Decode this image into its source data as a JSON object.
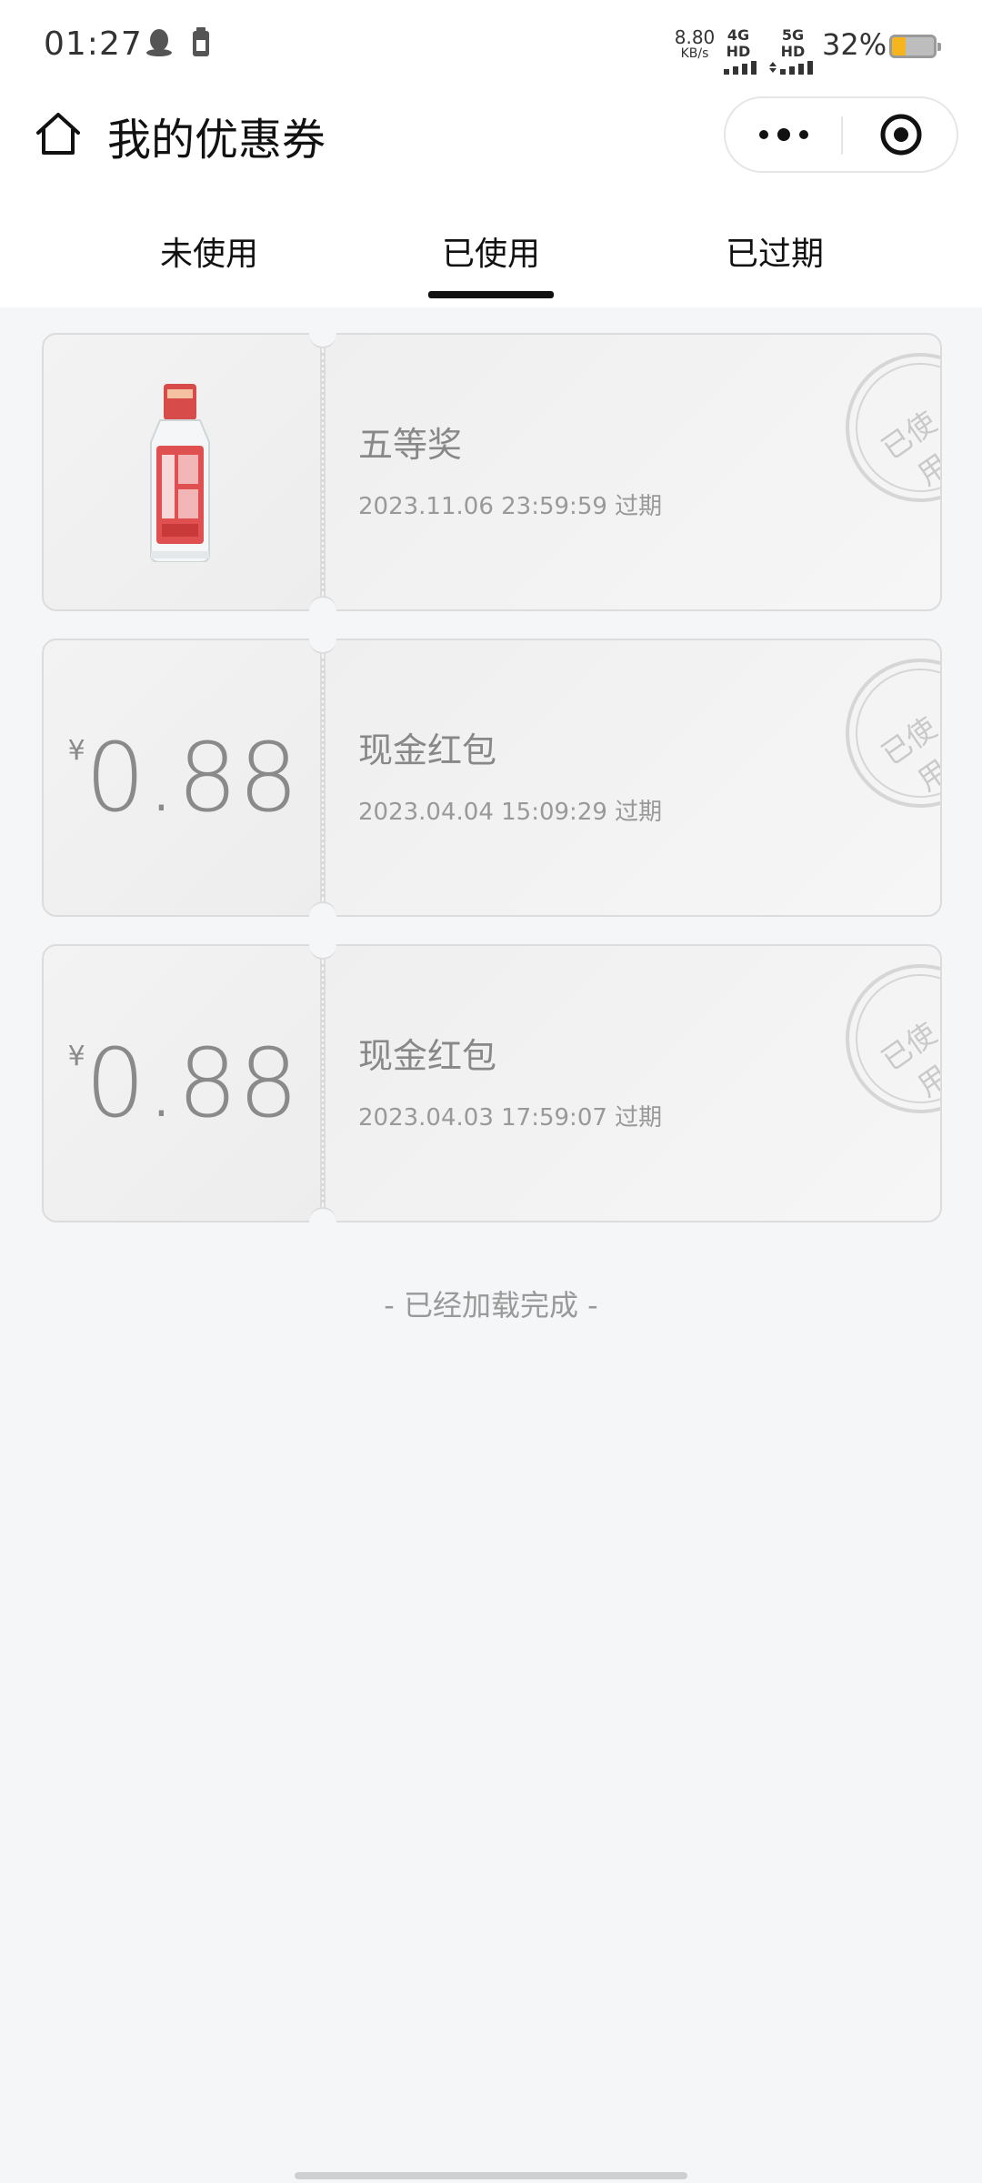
{
  "status_bar": {
    "time": "01:27",
    "net_speed_value": "8.80",
    "net_speed_unit": "KB/s",
    "signal_1_label": "4G HD",
    "signal_2_label": "5G HD",
    "battery_percent": "32%",
    "battery_level": 0.32,
    "battery_color": "#f6b51e"
  },
  "nav": {
    "title": "我的优惠券",
    "home_icon": "home-icon",
    "more_icon": "more-dots-icon",
    "close_icon": "target-close-icon"
  },
  "tabs": [
    {
      "label": "未使用",
      "active": false
    },
    {
      "label": "已使用",
      "active": true
    },
    {
      "label": "已过期",
      "active": false
    }
  ],
  "coupons": [
    {
      "type": "prize",
      "name": "五等奖",
      "date": "2023.11.06 23:59:59 过期",
      "stamp": "已使用",
      "image": "liquor-bottle"
    },
    {
      "type": "cash",
      "currency": "¥",
      "amount": "0.88",
      "name": "现金红包",
      "date": "2023.04.04 15:09:29 过期",
      "stamp": "已使用"
    },
    {
      "type": "cash",
      "currency": "¥",
      "amount": "0.88",
      "name": "现金红包",
      "date": "2023.04.03 17:59:07 过期",
      "stamp": "已使用"
    }
  ],
  "list_end_text": "- 已经加载完成 -"
}
